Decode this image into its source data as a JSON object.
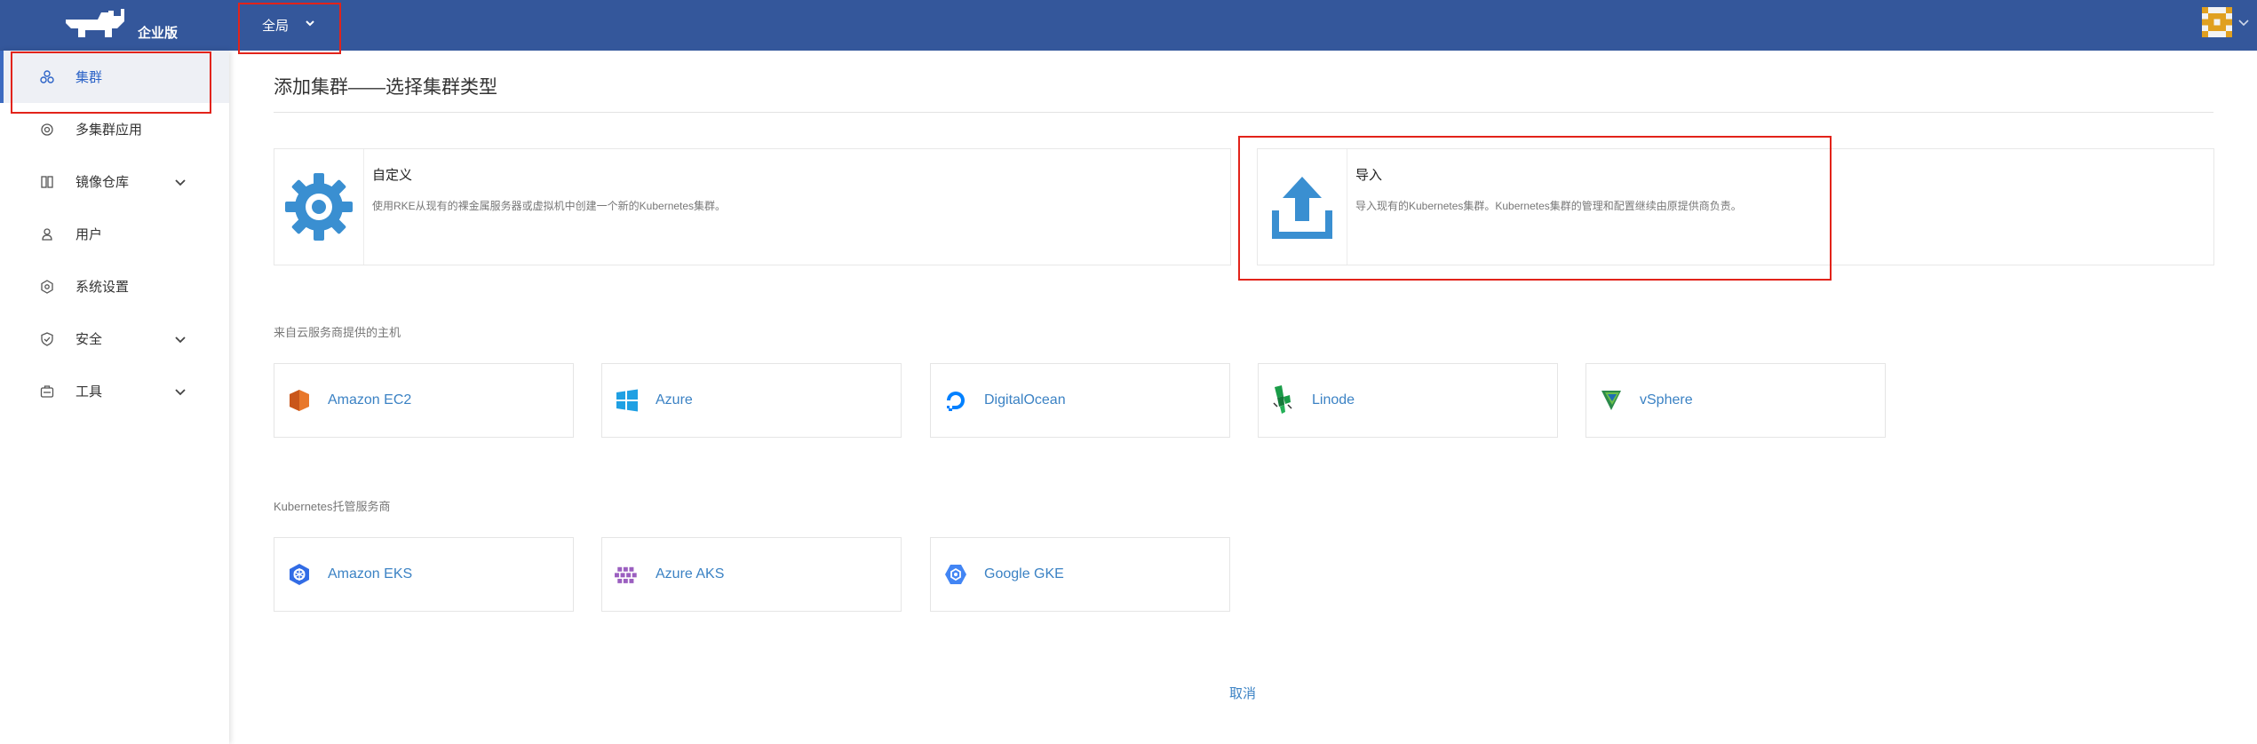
{
  "header": {
    "logo_text": "企业版",
    "scope_label": "全局"
  },
  "sidebar": {
    "items": [
      {
        "label": "集群",
        "icon": "cluster-icon",
        "active": true
      },
      {
        "label": "多集群应用",
        "icon": "multi-cluster-app-icon"
      },
      {
        "label": "镜像仓库",
        "icon": "registry-icon",
        "expandable": true
      },
      {
        "label": "用户",
        "icon": "user-icon"
      },
      {
        "label": "系统设置",
        "icon": "settings-icon"
      },
      {
        "label": "安全",
        "icon": "shield-icon",
        "expandable": true
      },
      {
        "label": "工具",
        "icon": "tools-icon",
        "expandable": true
      }
    ]
  },
  "main": {
    "title": "添加集群——选择集群类型",
    "custom_card": {
      "title": "自定义",
      "desc": "使用RKE从现有的裸金属服务器或虚拟机中创建一个新的Kubernetes集群。",
      "icon": "gear-icon"
    },
    "import_card": {
      "title": "导入",
      "desc": "导入现有的Kubernetes集群。Kubernetes集群的管理和配置继续由原提供商负责。",
      "icon": "upload-icon"
    },
    "cloud_section_label": "来自云服务商提供的主机",
    "cloud_providers": [
      "Amazon EC2",
      "Azure",
      "DigitalOcean",
      "Linode",
      "vSphere"
    ],
    "k8s_section_label": "Kubernetes托管服务商",
    "k8s_providers": [
      "Amazon EKS",
      "Azure AKS",
      "Google GKE"
    ],
    "cancel_label": "取消"
  },
  "colors": {
    "header_bg": "#34579b",
    "link": "#3b82c4",
    "highlight_box": "#e2231a",
    "icon_blue": "#3a8fd1"
  }
}
